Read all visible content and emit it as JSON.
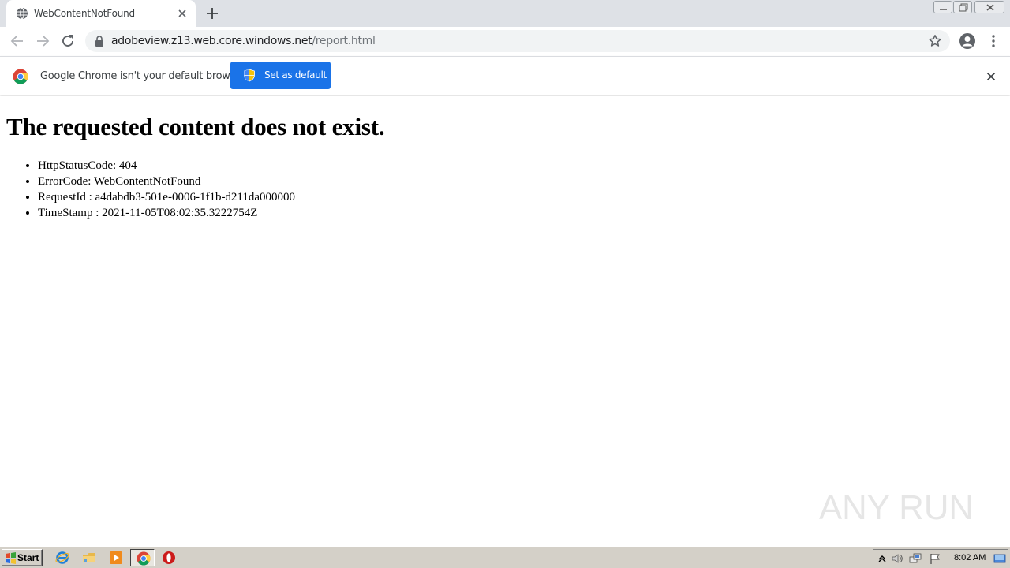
{
  "browser": {
    "tab": {
      "title": "WebContentNotFound"
    },
    "address_bar": {
      "host": "adobeview.z13.web.core.windows.net",
      "path": "/report.html"
    }
  },
  "infobar": {
    "message": "Google Chrome isn't your default browser",
    "button_label": "Set as default",
    "button_color": "#1a73e8"
  },
  "page": {
    "heading": "The requested content does not exist.",
    "details": [
      "HttpStatusCode: 404",
      "ErrorCode: WebContentNotFound",
      "RequestId : a4dabdb3-501e-0006-1f1b-d211da000000",
      "TimeStamp : 2021-11-05T08:02:35.3222754Z"
    ]
  },
  "watermark": {
    "text": "ANY RUN"
  },
  "taskbar": {
    "start_label": "Start",
    "clock": "8:02 AM",
    "pinned_icons": [
      "internet-explorer-icon",
      "windows-explorer-icon",
      "media-player-icon",
      "chrome-icon",
      "opera-icon"
    ]
  }
}
